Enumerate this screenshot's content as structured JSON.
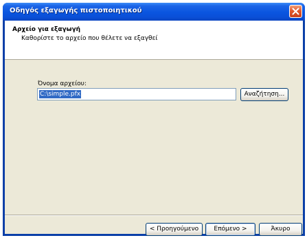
{
  "window": {
    "title": "Οδηγός εξαγωγής πιστοποιητικού"
  },
  "header": {
    "title": "Αρχείο για εξαγωγή",
    "subtitle": "Καθορίστε το αρχείο που θέλετε να εξαγθεί"
  },
  "form": {
    "file_label": "Όνομα αρχείου:",
    "file_value": "C:\\simple.pfx",
    "browse_label": "Αναζήτηση..."
  },
  "footer": {
    "back_label": "< Προηγούμενο",
    "next_label": "Επόμενο >",
    "cancel_label": "Άκυρο"
  },
  "colors": {
    "titlebar": "#0a55df",
    "dialog_bg": "#ece9d8",
    "selection": "#316ac5",
    "close_button": "#e2582c"
  },
  "icons": {
    "close": "close-icon"
  }
}
